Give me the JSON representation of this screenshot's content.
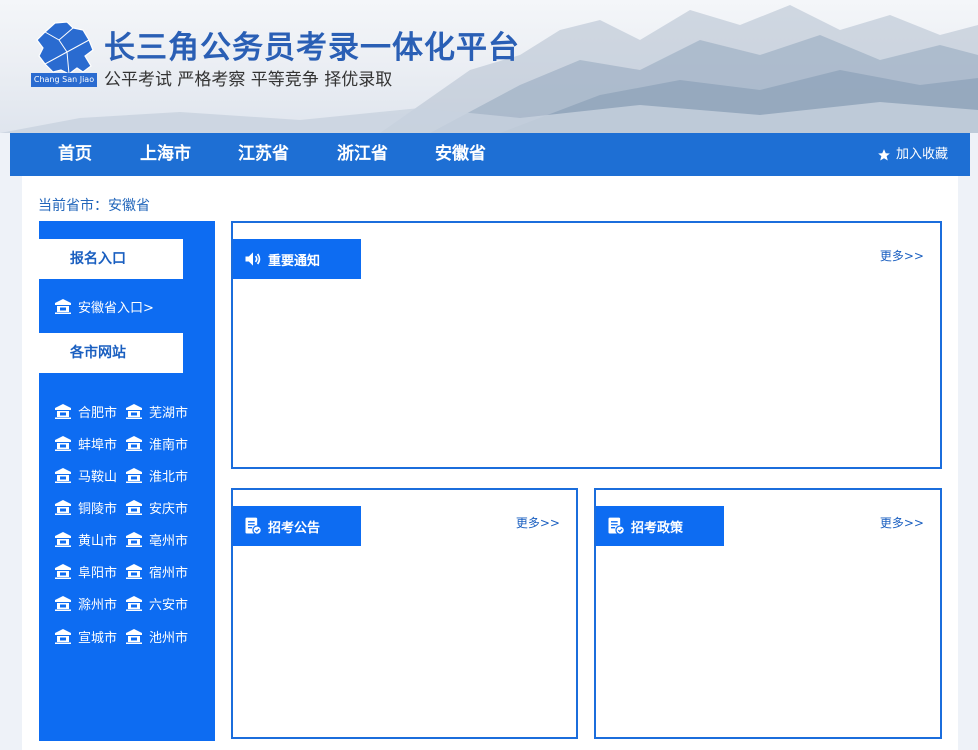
{
  "header": {
    "title": "长三角公务员考录一体化平台",
    "slogan": "公平考试 严格考察 平等竞争 择优录取",
    "logo_caption": "Chang San Jiao",
    "logo_icon": "region-map-logo"
  },
  "nav": {
    "items": [
      "首页",
      "上海市",
      "江苏省",
      "浙江省",
      "安徽省"
    ],
    "favorite_label": "加入收藏",
    "favorite_icon": "star-icon"
  },
  "breadcrumb": "当前省市：安徽省",
  "sidebar": {
    "registration_heading": "报名入口",
    "registration_link": "安徽省入口>",
    "cities_heading": "各市网站",
    "cities": [
      "合肥市",
      "芜湖市",
      "蚌埠市",
      "淮南市",
      "马鞍山",
      "淮北市",
      "铜陵市",
      "安庆市",
      "黄山市",
      "亳州市",
      "阜阳市",
      "宿州市",
      "滁州市",
      "六安市",
      "宣城市",
      "池州市"
    ],
    "link_icon": "building-icon"
  },
  "panels": {
    "notice": {
      "title": "重要通知",
      "more": "更多>>",
      "icon": "speaker-icon"
    },
    "recruit": {
      "title": "招考公告",
      "more": "更多>>",
      "icon": "document-icon"
    },
    "policy": {
      "title": "招考政策",
      "more": "更多>>",
      "icon": "document-icon"
    }
  },
  "colors": {
    "brand_blue": "#0d6cf2",
    "nav_blue": "#1e6fd4",
    "title_blue": "#2a5fb5",
    "link_blue": "#1a5fc0"
  }
}
